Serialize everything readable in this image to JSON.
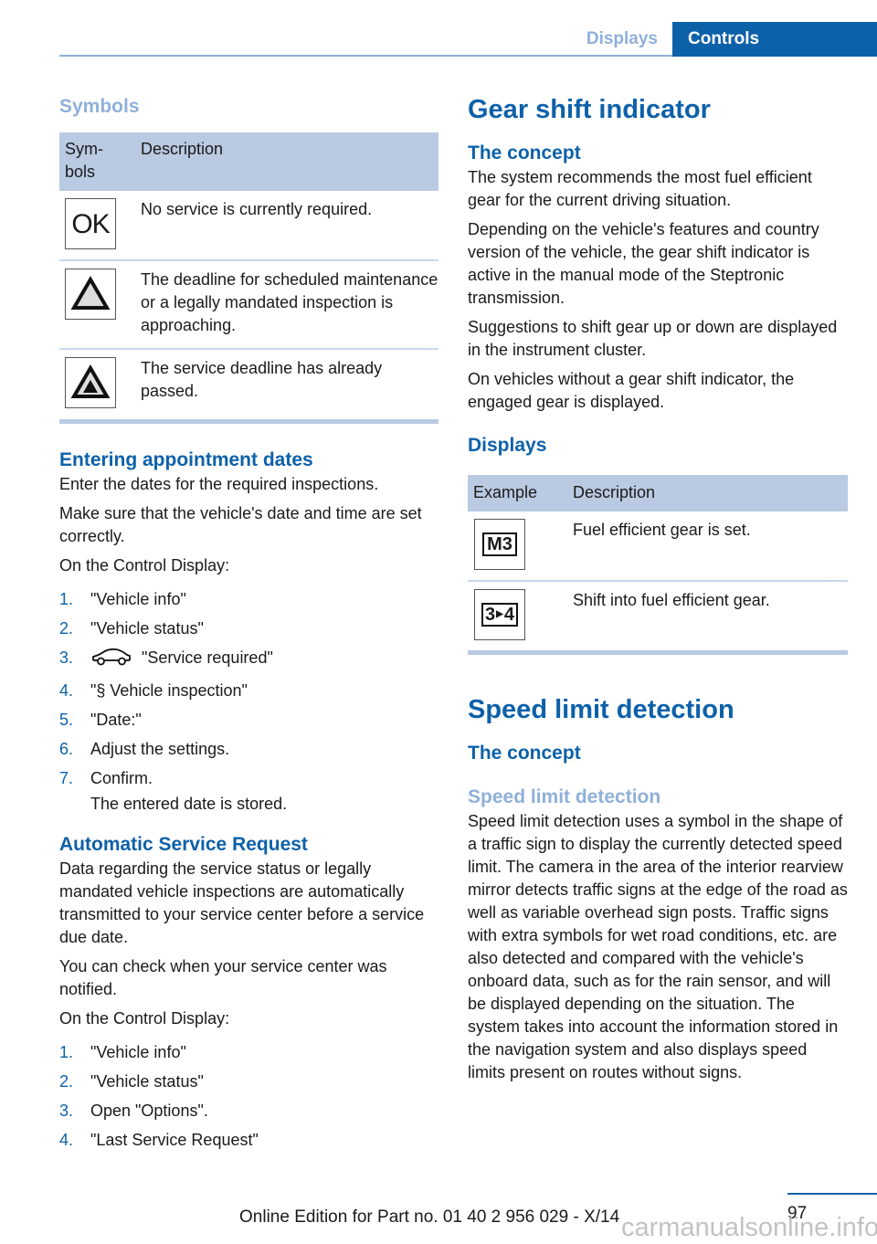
{
  "header": {
    "section": "Displays",
    "chapter": "Controls"
  },
  "left": {
    "symbols_heading": "Symbols",
    "symbols_table": {
      "headers": [
        "Sym-\nbols",
        "Description"
      ],
      "header_sym": "Sym-",
      "header_sym2": "bols",
      "header_desc": "Description",
      "rows": [
        {
          "icon": "ok-icon",
          "icon_text": "OK",
          "description": "No service is currently required."
        },
        {
          "icon": "warning-triangle-icon",
          "description": "The deadline for scheduled maintenance or a legally mandated inspection is approaching."
        },
        {
          "icon": "overdue-triangle-icon",
          "description": "The service deadline has already passed."
        }
      ]
    },
    "appointments": {
      "heading": "Entering appointment dates",
      "intro": "Enter the dates for the required inspections.",
      "note": "Make sure that the vehicle's date and time are set correctly.",
      "lead": "On the Control Display:",
      "steps": [
        {
          "num": "1.",
          "text": "\"Vehicle info\""
        },
        {
          "num": "2.",
          "text": "\"Vehicle status\""
        },
        {
          "num": "3.",
          "text": "\"Service required\"",
          "icon": "car-icon"
        },
        {
          "num": "4.",
          "text": "\"§ Vehicle inspection\""
        },
        {
          "num": "5.",
          "text": "\"Date:\""
        },
        {
          "num": "6.",
          "text": "Adjust the settings."
        },
        {
          "num": "7.",
          "text": "Confirm."
        }
      ],
      "result": "The entered date is stored."
    },
    "auto_request": {
      "heading": "Automatic Service Request",
      "p1": "Data regarding the service status or legally mandated vehicle inspections are automatically transmitted to your service center before a service due date.",
      "p2": "You can check when your service center was notified.",
      "lead": "On the Control Display:",
      "steps": [
        {
          "num": "1.",
          "text": "\"Vehicle info\""
        },
        {
          "num": "2.",
          "text": "\"Vehicle status\""
        },
        {
          "num": "3.",
          "text": "Open \"Options\"."
        },
        {
          "num": "4.",
          "text": "\"Last Service Request\""
        }
      ]
    }
  },
  "right": {
    "gear": {
      "heading": "Gear shift indicator",
      "concept_heading": "The concept",
      "p1": "The system recommends the most fuel efficient gear for the current driving situation.",
      "p2": "Depending on the vehicle's features and country version of the vehicle, the gear shift indicator is active in the manual mode of the Steptronic transmission.",
      "p3": "Suggestions to shift gear up or down are displayed in the instrument cluster.",
      "p4": "On vehicles without a gear shift indicator, the engaged gear is displayed.",
      "displays_heading": "Displays",
      "table": {
        "header_example": "Example",
        "header_desc": "Description",
        "rows": [
          {
            "icon": "gear-m3-icon",
            "icon_text": "M3",
            "description": "Fuel efficient gear is set."
          },
          {
            "icon": "shift-3-to-4-icon",
            "icon_text_a": "3",
            "icon_text_b": "4",
            "description": "Shift into fuel efficient gear."
          }
        ]
      }
    },
    "speed": {
      "heading": "Speed limit detection",
      "concept_heading": "The concept",
      "sub_heading": "Speed limit detection",
      "p1": "Speed limit detection uses a symbol in the shape of a traffic sign to display the currently detected speed limit. The camera in the area of the interior rearview mirror detects traffic signs at the edge of the road as well as variable overhead sign posts. Traffic signs with extra symbols for wet road conditions, etc. are also detected and compared with the vehicle's onboard data, such as for the rain sensor, and will be displayed depending on the situation. The system takes into account the information stored in the navigation system and also displays speed limits present on routes without signs."
    }
  },
  "footer": {
    "edition": "Online Edition for Part no. 01 40 2 956 029 - X/14",
    "page": "97",
    "watermark": "carmanualsonline.info"
  }
}
